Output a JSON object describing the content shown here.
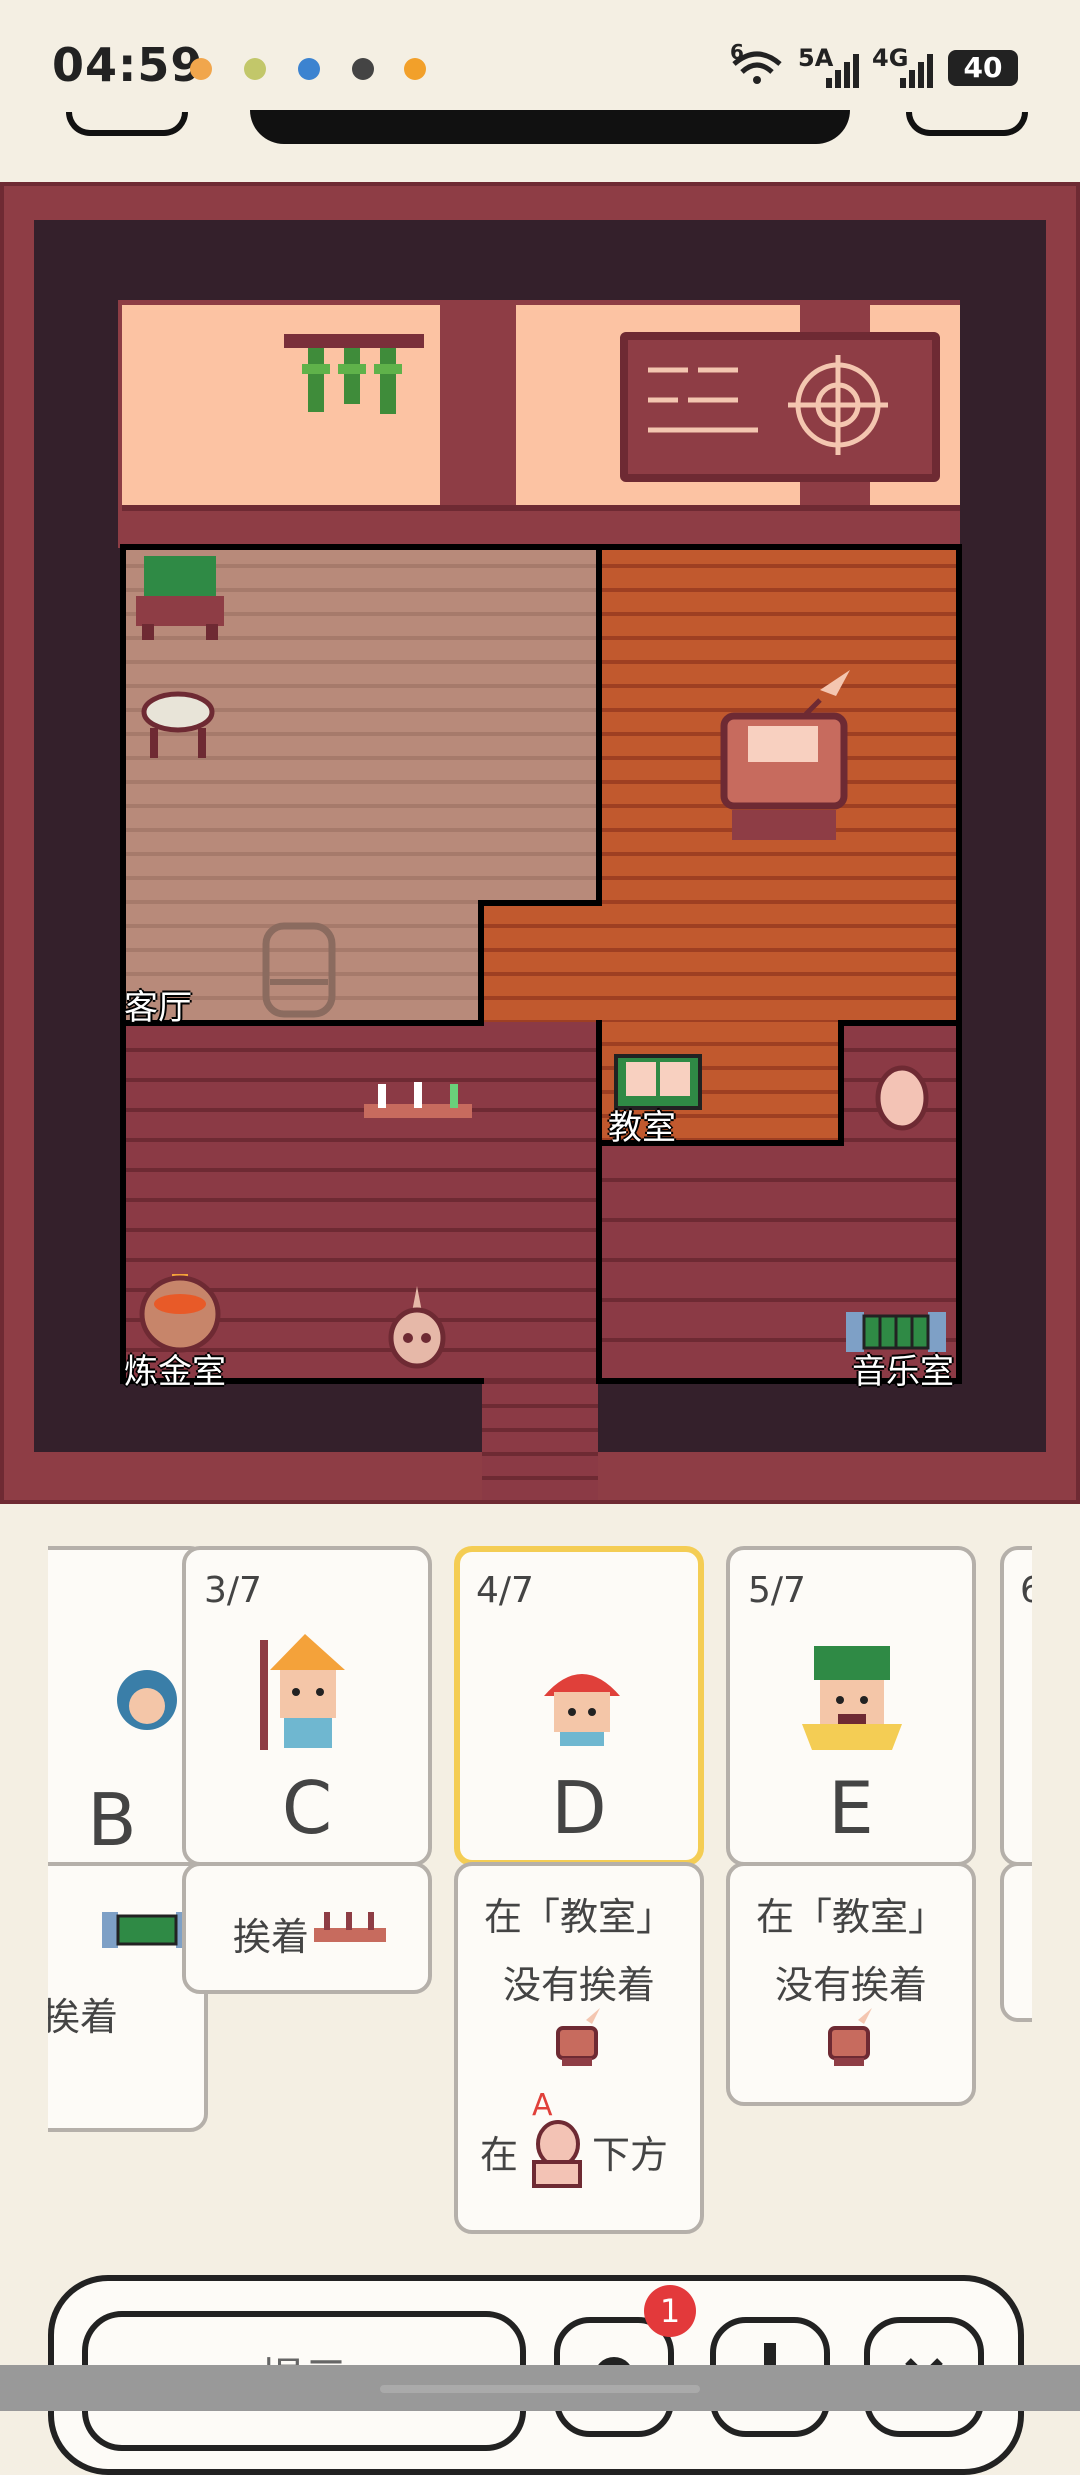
{
  "status_bar": {
    "time": "04:59",
    "network_labels": [
      "6",
      "5A",
      "4G"
    ],
    "battery": "40",
    "icons": [
      "app-icon-1",
      "app-icon-2",
      "chat-icon",
      "app-icon-4",
      "app-icon-5",
      "wifi-icon",
      "signal-icon",
      "signal-icon-2"
    ]
  },
  "board": {
    "rooms": {
      "living_room": "客厅",
      "classroom": "教室",
      "alchemy_room": "炼金室",
      "music_room": "音乐室"
    },
    "colors": {
      "frame": "#8e3d45",
      "wood_floor": "#b88a7a",
      "orange_floor": "#c1592e",
      "brick_floor": "#8b3a45",
      "wall": "#fcc3a3"
    }
  },
  "cards": [
    {
      "count": "",
      "letter": "B",
      "clue_parts": [
        "挨着"
      ]
    },
    {
      "count": "3/7",
      "letter": "C",
      "clue_parts": [
        "挨着"
      ]
    },
    {
      "count": "4/7",
      "letter": "D",
      "selected": true,
      "clue_parts": [
        "在「教室」",
        "没有挨着",
        "在",
        "下方"
      ],
      "clue_marker": "A"
    },
    {
      "count": "5/7",
      "letter": "E",
      "clue_parts": [
        "在「教室」",
        "没有挨着"
      ]
    },
    {
      "count": "6",
      "letter": "",
      "clue_parts": []
    }
  ],
  "bottom_bar": {
    "hint_button": "提示",
    "badge_count": "1"
  }
}
